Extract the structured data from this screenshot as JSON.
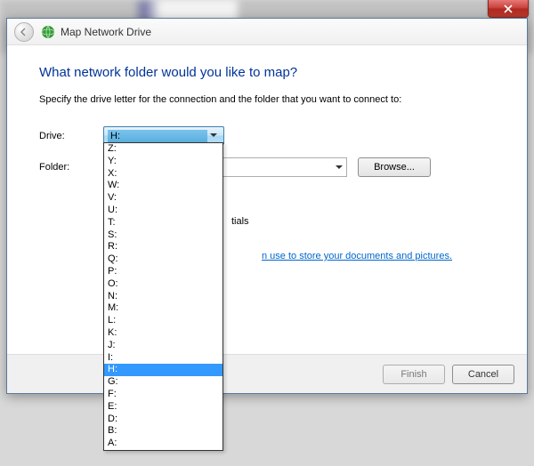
{
  "closeButton": "Close",
  "header": {
    "title": "Map Network Drive"
  },
  "body": {
    "heading": "What network folder would you like to map?",
    "instruction": "Specify the drive letter for the connection and the folder that you want to connect to:",
    "driveLabel": "Drive:",
    "folderLabel": "Folder:",
    "driveValue": "H:",
    "browseLabel": "Browse...",
    "partialTextVisible": "tials",
    "partialLinkVisible": "n use to store your documents and pictures."
  },
  "footer": {
    "finishLabel": "Finish",
    "cancelLabel": "Cancel"
  },
  "driveOptions": [
    "Z:",
    "Y:",
    "X:",
    "W:",
    "V:",
    "U:",
    "T:",
    "S:",
    "R:",
    "Q:",
    "P:",
    "O:",
    "N:",
    "M:",
    "L:",
    "K:",
    "J:",
    "I:",
    "H:",
    "G:",
    "F:",
    "E:",
    "D:",
    "B:",
    "A:"
  ],
  "highlightedOption": "H:"
}
